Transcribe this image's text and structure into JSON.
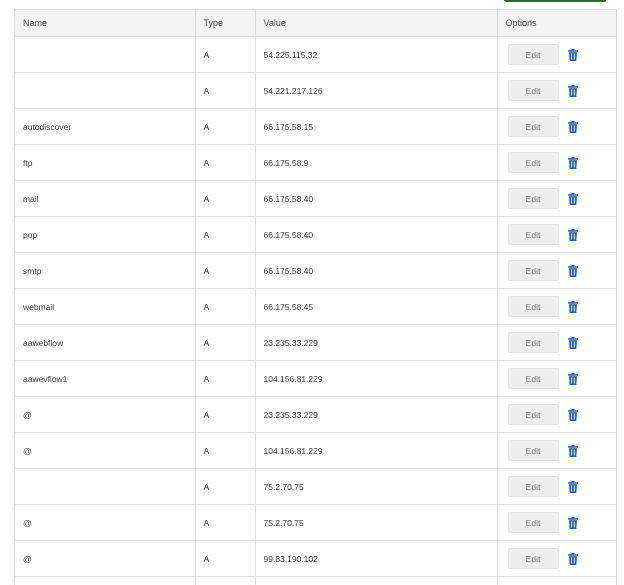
{
  "colors": {
    "trash_icon": "#1f5fb4",
    "header_bg": "#f3f3f3",
    "edit_button_bg": "#eeeeee"
  },
  "table": {
    "headers": {
      "name": "Name",
      "type": "Type",
      "value": "Value",
      "options": "Options"
    },
    "edit_label": "Edit",
    "rows": [
      {
        "name": "",
        "type": "A",
        "value": "54.225.115.32"
      },
      {
        "name": "",
        "type": "A",
        "value": "54.221.217.126"
      },
      {
        "name": "autodiscover",
        "type": "A",
        "value": "66.175.58.15"
      },
      {
        "name": "ftp",
        "type": "A",
        "value": "66.175.58.9"
      },
      {
        "name": "mail",
        "type": "A",
        "value": "66.175.58.40"
      },
      {
        "name": "pop",
        "type": "A",
        "value": "66.175.58.40"
      },
      {
        "name": "smtp",
        "type": "A",
        "value": "66.175.58.40"
      },
      {
        "name": "webmail",
        "type": "A",
        "value": "66.175.58.45"
      },
      {
        "name": "aawebflow",
        "type": "A",
        "value": "23.235.33.229"
      },
      {
        "name": "aawevflow1",
        "type": "A",
        "value": "104.156.81.229"
      },
      {
        "name": "@",
        "type": "A",
        "value": "23.235.33.229"
      },
      {
        "name": "@",
        "type": "A",
        "value": "104.156.81.229"
      },
      {
        "name": "",
        "type": "A",
        "value": "75.2.70.75"
      },
      {
        "name": "@",
        "type": "A",
        "value": "75.2.70.75"
      },
      {
        "name": "@",
        "type": "A",
        "value": "99.83.190.102"
      },
      {
        "name": "",
        "type": "",
        "value": ""
      }
    ]
  }
}
